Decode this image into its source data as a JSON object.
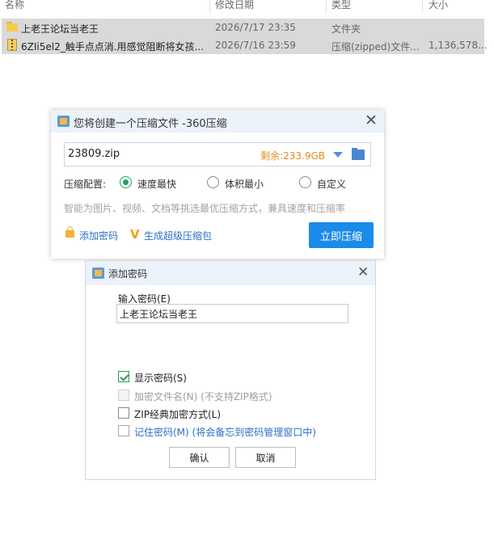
{
  "explorer": {
    "columns": {
      "name": "名称",
      "modified": "修改日期",
      "type": "类型",
      "size": "大小"
    },
    "rows": [
      {
        "name": "上老王论坛当老王",
        "modified": "2026/7/17 23:35",
        "type": "文件夹",
        "size": "",
        "icon": "folder-icon"
      },
      {
        "name": "6ZIi5el2_触手点点消.用感觉阻断将女孩...",
        "modified": "2026/7/16 23:59",
        "type": "压缩(zipped)文件...",
        "size": "1,136,578...",
        "icon": "zip-file-icon"
      }
    ]
  },
  "compress_dialog": {
    "title": "您将创建一个压缩文件 -360压缩",
    "filename": "23809.zip",
    "free_space": "剩余:233.9GB",
    "config_label": "压缩配置:",
    "options": [
      "速度最快",
      "体积最小",
      "自定义"
    ],
    "selected_option": "速度最快",
    "hint": "智能为图片、视频、文档等挑选最优压缩方式，兼具速度和压缩率",
    "add_password_link": "添加密码",
    "super_package_link": "生成超级压缩包",
    "compress_button": "立即压缩",
    "accent_color": "#1a8be8"
  },
  "password_dialog": {
    "title": "添加密码",
    "input_label": "输入密码(E)",
    "password_value": "上老王论坛当老王",
    "show_password": {
      "label": "显示密码(S)",
      "checked": true
    },
    "encrypt_filenames": {
      "label": "加密文件名(N) (不支持ZIP格式)",
      "checked": false,
      "disabled": true
    },
    "zip_classic": {
      "label": "ZIP经典加密方式(L)",
      "checked": false
    },
    "remember_password": {
      "label": "记住密码(M) (将会备忘到密码管理窗口中)",
      "checked": false
    },
    "ok_button": "确认",
    "cancel_button": "取消"
  }
}
